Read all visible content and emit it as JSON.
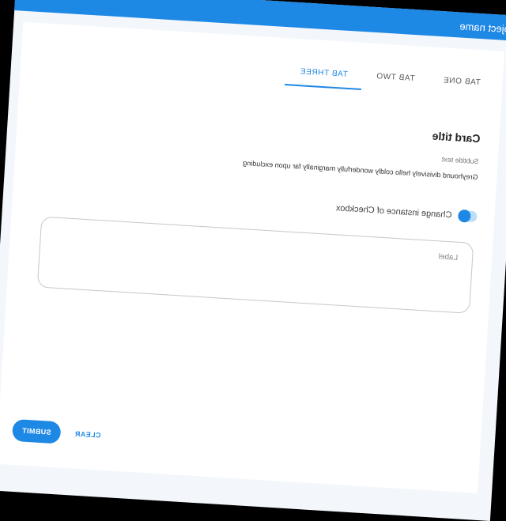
{
  "app": {
    "title": "Project name"
  },
  "tabs": [
    {
      "label": "TAB ONE",
      "active": false
    },
    {
      "label": "TAB TWO",
      "active": false
    },
    {
      "label": "TAB THREE",
      "active": true
    }
  ],
  "card": {
    "title": "Card title",
    "subtitle": "Subtitle text",
    "body": "Greyhound divisively hello coldly wonderfully marginally far upon excluding"
  },
  "checkbox": {
    "label": "Change instance of Checkbox",
    "checked": true
  },
  "text_field": {
    "label": "Label",
    "value": ""
  },
  "actions": {
    "clear_label": "CLEAR",
    "submit_label": "SUBMIT"
  },
  "colors": {
    "accent": "#1e88e5",
    "page_background": "#f3f7fc",
    "card_background": "#ffffff"
  },
  "icons": {
    "logo": "app-logo-icon"
  }
}
